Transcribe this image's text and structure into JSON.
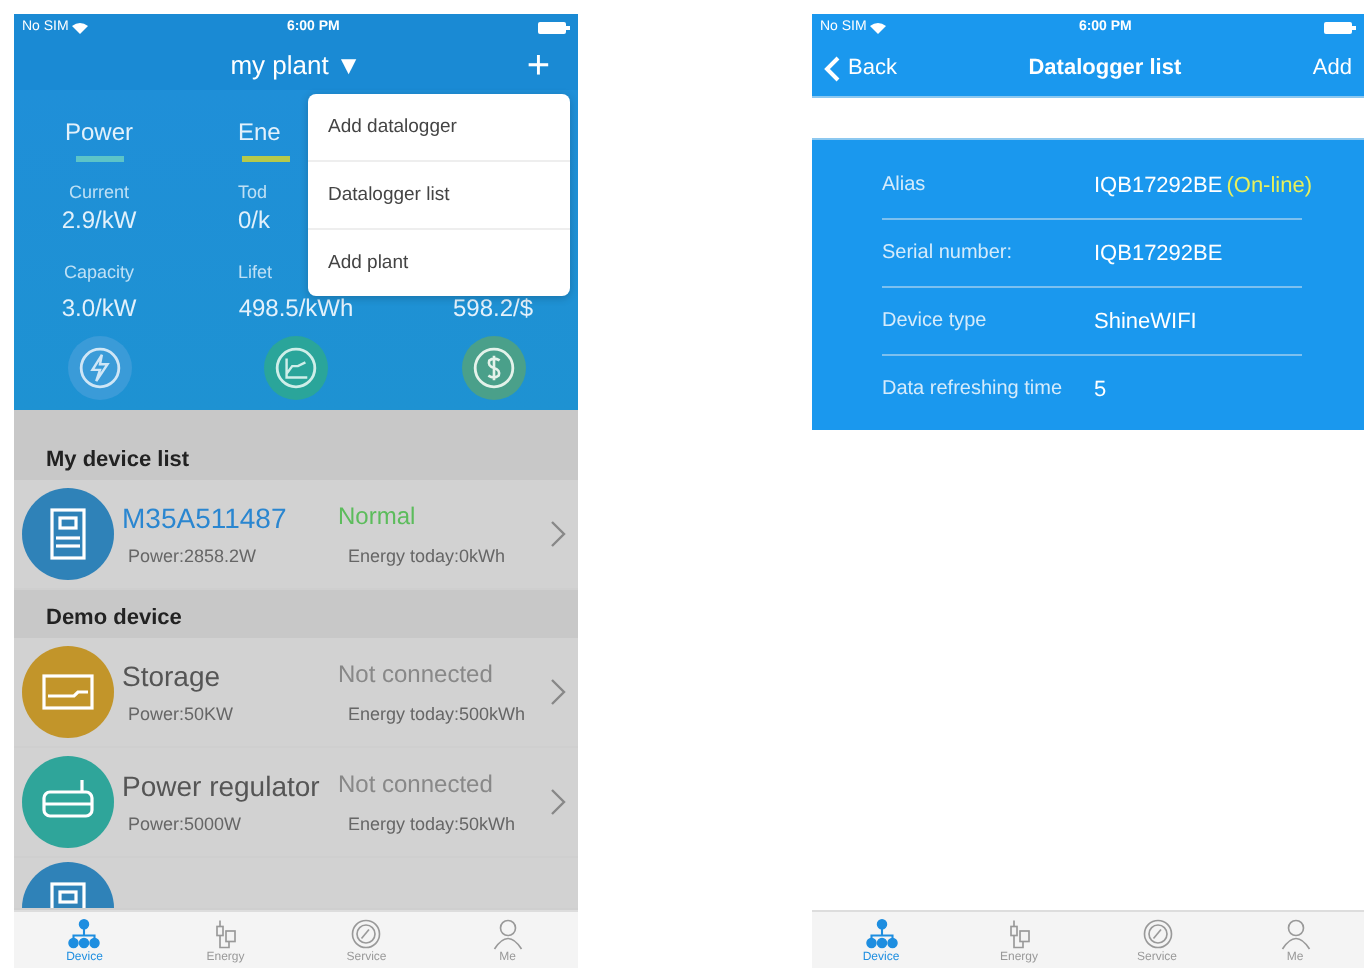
{
  "left_phone": {
    "status_bar": {
      "carrier": "No SIM",
      "time": "6:00 PM"
    },
    "header": {
      "title": "my plant",
      "caret": "▼",
      "add": "+"
    },
    "metrics": [
      {
        "tab": "Power",
        "color": "#5cc4c8",
        "label_1": "Current",
        "value_1": "2.9/kW",
        "label_2": "Capacity",
        "value_2": "3.0/kW"
      },
      {
        "tab": "Ene",
        "color": "#b5c94a",
        "label_1": "Tod",
        "value_1": "0/k",
        "label_2": "Lifet",
        "value_2": "498.5/kWh"
      },
      {
        "value_2": "598.2/$"
      }
    ],
    "menu": [
      "Add datalogger",
      "Datalogger list",
      "Add plant"
    ],
    "sections": [
      {
        "title": "My device list",
        "devices": [
          {
            "kind": "inverter",
            "name": "M35A511487",
            "status": "Normal",
            "power": "Power:2858.2W",
            "energy": "Energy today:0kWh",
            "online": true,
            "color": "#2f82b8"
          }
        ]
      },
      {
        "title": "Demo device",
        "devices": [
          {
            "kind": "storage",
            "name": "Storage",
            "status": "Not connected",
            "power": "Power:50KW",
            "energy": "Energy today:500kWh",
            "online": false,
            "color": "#c2952a"
          },
          {
            "kind": "regulator",
            "name": "Power regulator",
            "status": "Not connected",
            "power": "Power:5000W",
            "energy": "Energy today:50kWh",
            "online": false,
            "color": "#2fa59a"
          },
          {
            "kind": "inverter",
            "color": "#2f82b8"
          }
        ]
      }
    ],
    "tab_bar": [
      {
        "label": "Device",
        "selected": true
      },
      {
        "label": "Energy",
        "selected": false
      },
      {
        "label": "Service",
        "selected": false
      },
      {
        "label": "Me",
        "selected": false
      }
    ]
  },
  "right_phone": {
    "status_bar": {
      "carrier": "No SIM",
      "time": "6:00 PM"
    },
    "nav": {
      "back": "Back",
      "title": "Datalogger list",
      "action": "Add"
    },
    "details": [
      {
        "label": "Alias",
        "value": "IQB17292BE",
        "status": "(On-line)"
      },
      {
        "label": "Serial number:",
        "value": "IQB17292BE"
      },
      {
        "label": "Device type",
        "value": "ShineWIFI"
      },
      {
        "label": "Data refreshing time",
        "value": "5"
      }
    ],
    "tab_bar": [
      {
        "label": "Device",
        "selected": true
      },
      {
        "label": "Energy",
        "selected": false
      },
      {
        "label": "Service",
        "selected": false
      },
      {
        "label": "Me",
        "selected": false
      }
    ]
  }
}
